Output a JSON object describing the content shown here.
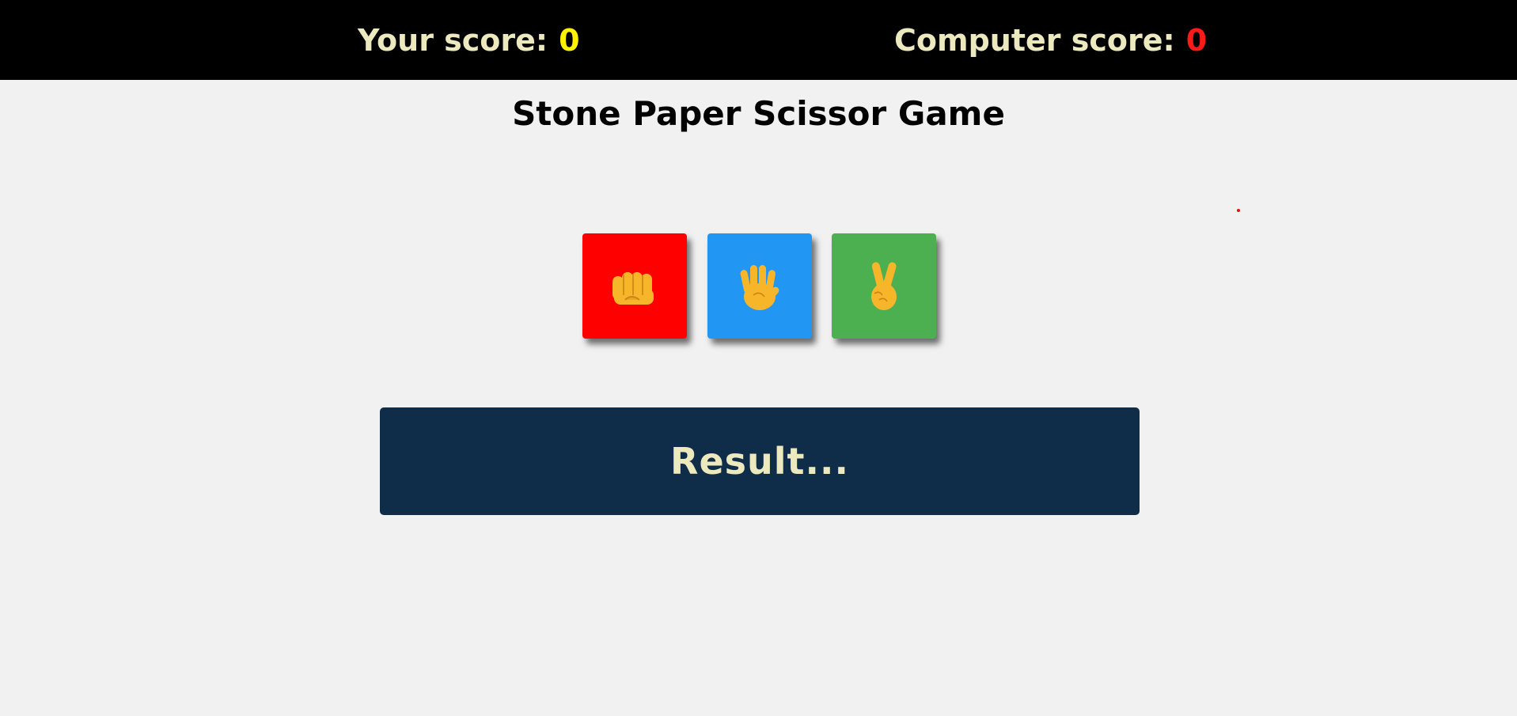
{
  "scores": {
    "you_label": "Your score:",
    "you_value": "0",
    "computer_label": "Computer score:",
    "computer_value": "0"
  },
  "title": "Stone Paper Scissor Game",
  "choices": [
    {
      "id": "stone",
      "icon": "fist-icon",
      "color": "#ff0000"
    },
    {
      "id": "paper",
      "icon": "raised-hand-icon",
      "color": "#2196f3"
    },
    {
      "id": "scissor",
      "icon": "victory-hand-icon",
      "color": "#4caf50"
    }
  ],
  "result": "Result...",
  "colors": {
    "scorebar": "#000000",
    "score_label": "#ece9bf",
    "your_score": "#fff200",
    "computer_score": "#ff1a1a",
    "result_box": "#0f2c48"
  }
}
